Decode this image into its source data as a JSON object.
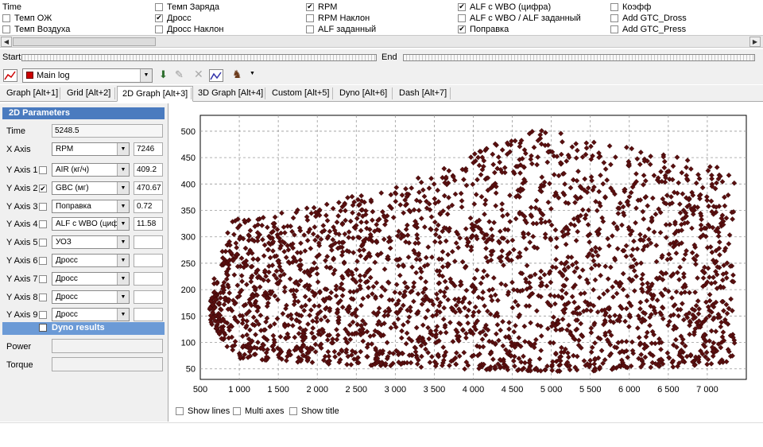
{
  "channels": [
    {
      "label": "Time",
      "checked": null
    },
    {
      "label": "Темп ОЖ",
      "checked": false
    },
    {
      "label": "Темп Воздуха",
      "checked": false
    },
    {
      "label": "Темп Заряда",
      "checked": false
    },
    {
      "label": "Дросс",
      "checked": true
    },
    {
      "label": "Дросс Наклон",
      "checked": false
    },
    {
      "label": "RPM",
      "checked": true
    },
    {
      "label": "RPM Наклон",
      "checked": false
    },
    {
      "label": "ALF заданный",
      "checked": false
    },
    {
      "label": "ALF с WBO (цифра)",
      "checked": true
    },
    {
      "label": "ALF с WBO / ALF заданный",
      "checked": false
    },
    {
      "label": "Поправка",
      "checked": true
    },
    {
      "label": "Коэфф",
      "checked": false
    },
    {
      "label": "Add GTC_Dross",
      "checked": false
    },
    {
      "label": "Add GTC_Press",
      "checked": false
    }
  ],
  "range": {
    "start_label": "Start",
    "end_label": "End"
  },
  "toolbar": {
    "log_select": "Main log",
    "log_color": "#cc0000"
  },
  "tabs": [
    "Graph [Alt+1]",
    "Grid [Alt+2]",
    "2D Graph [Alt+3]",
    "3D Graph [Alt+4]",
    "Custom [Alt+5]",
    "Dyno [Alt+6]",
    "Dash [Alt+7]"
  ],
  "active_tab": 2,
  "params": {
    "title": "2D Parameters",
    "time_label": "Time",
    "time_value": "5248.5",
    "xaxis_label": "X Axis",
    "xaxis_select": "RPM",
    "xaxis_value": "7246",
    "yaxes": [
      {
        "label": "Y Axis 1",
        "checked": false,
        "select": "AIR (кг/ч)",
        "value": "409.2"
      },
      {
        "label": "Y Axis 2",
        "checked": true,
        "select": "GBC (мг)",
        "value": "470.67"
      },
      {
        "label": "Y Axis 3",
        "checked": false,
        "select": "Поправка",
        "value": "0.72"
      },
      {
        "label": "Y Axis 4",
        "checked": false,
        "select": "ALF с WBO (циф",
        "value": "11.58"
      },
      {
        "label": "Y Axis 5",
        "checked": false,
        "select": "УОЗ",
        "value": ""
      },
      {
        "label": "Y Axis 6",
        "checked": false,
        "select": "Дросс",
        "value": ""
      },
      {
        "label": "Y Axis 7",
        "checked": false,
        "select": "Дросс",
        "value": ""
      },
      {
        "label": "Y Axis 8",
        "checked": false,
        "select": "Дросс",
        "value": ""
      },
      {
        "label": "Y Axis 9",
        "checked": false,
        "select": "Дросс",
        "value": ""
      }
    ],
    "dyno_label": "Dyno results",
    "power_label": "Power",
    "torque_label": "Torque"
  },
  "chart_options": {
    "show_lines": "Show lines",
    "multi_axes": "Multi axes",
    "show_title": "Show title"
  },
  "chart_data": {
    "type": "scatter",
    "title": "",
    "xlabel": "",
    "ylabel": "",
    "xlim": [
      500,
      7500
    ],
    "ylim": [
      30,
      530
    ],
    "xticks": [
      "500",
      "1 000",
      "1 500",
      "2 000",
      "2 500",
      "3 000",
      "3 500",
      "4 000",
      "4 500",
      "5 000",
      "5 500",
      "6 000",
      "6 500",
      "7 000"
    ],
    "yticks": [
      "50",
      "100",
      "150",
      "200",
      "250",
      "300",
      "350",
      "400",
      "450",
      "500"
    ],
    "grid": true,
    "marker_color": "#5a0f0f",
    "series": [
      {
        "name": "",
        "points": []
      }
    ],
    "envelope": {
      "rpm": [
        620,
        900,
        1000,
        1500,
        2000,
        2500,
        3000,
        3500,
        3800,
        4200,
        4500,
        4800,
        5000,
        5300,
        5500,
        6000,
        6500,
        7000,
        7350
      ],
      "gbc_min": [
        140,
        80,
        70,
        65,
        60,
        57,
        55,
        52,
        50,
        48,
        47,
        46,
        45,
        45,
        46,
        48,
        52,
        58,
        65
      ],
      "gbc_max": [
        200,
        330,
        340,
        345,
        360,
        380,
        400,
        420,
        445,
        470,
        495,
        505,
        500,
        490,
        480,
        470,
        455,
        440,
        430
      ]
    }
  }
}
